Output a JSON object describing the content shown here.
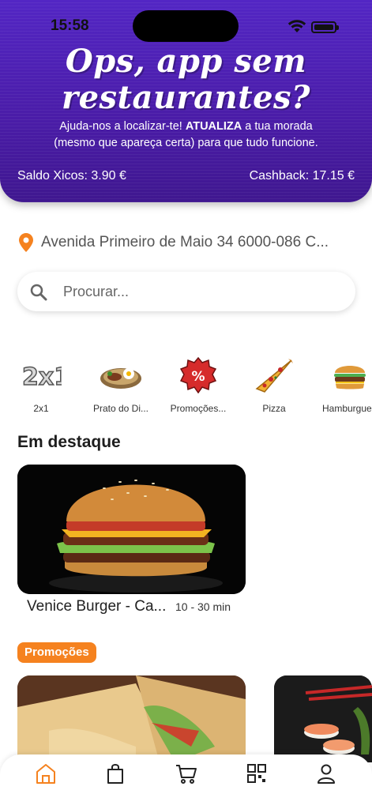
{
  "status": {
    "time": "15:58"
  },
  "banner": {
    "headline_line1": "Ops, app sem",
    "headline_line2": "restaurantes?",
    "sub_part1": "Ajuda-nos a localizar-te! ",
    "sub_bold": "ATUALIZA",
    "sub_part2": " a tua morada",
    "sub_line2": "(mesmo que apareça certa) para que tudo funcione.",
    "saldo": "Saldo Xicos: 3.90 €",
    "cashback": "Cashback: 17.15 €"
  },
  "address": {
    "text": "Avenida Primeiro de Maio 34 6000-086 C..."
  },
  "search": {
    "placeholder": "Procurar..."
  },
  "categories": [
    {
      "label": "2x1",
      "icon": "2x1-icon"
    },
    {
      "label": "Prato do Di...",
      "icon": "plate-icon"
    },
    {
      "label": "Promoções...",
      "icon": "percent-badge-icon"
    },
    {
      "label": "Pizza",
      "icon": "pizza-icon"
    },
    {
      "label": "Hamburgue",
      "icon": "burger-icon"
    }
  ],
  "featured": {
    "title": "Em destaque",
    "card_name": "Venice Burger - Ca...",
    "card_time": "10 - 30 min"
  },
  "promos": {
    "badge": "Promoções"
  },
  "nav": {
    "items": [
      "home-icon",
      "bag-icon",
      "cart-icon",
      "qr-icon",
      "user-icon"
    ],
    "active_color": "#f5821f"
  },
  "colors": {
    "banner": "#4a1fb0",
    "accent": "#f5821f"
  }
}
